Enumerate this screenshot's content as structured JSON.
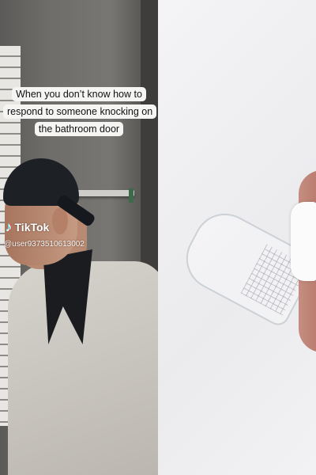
{
  "caption": "When you don’t know how to respond to someone knocking on the bathroom door",
  "watermark": {
    "logo_text": "TikTok",
    "username": "@user9373510613002"
  },
  "colors": {
    "caption_bg": "#f5f5f3",
    "tiktok_cyan": "#25f4ee",
    "tiktok_red": "#fe2c55"
  }
}
